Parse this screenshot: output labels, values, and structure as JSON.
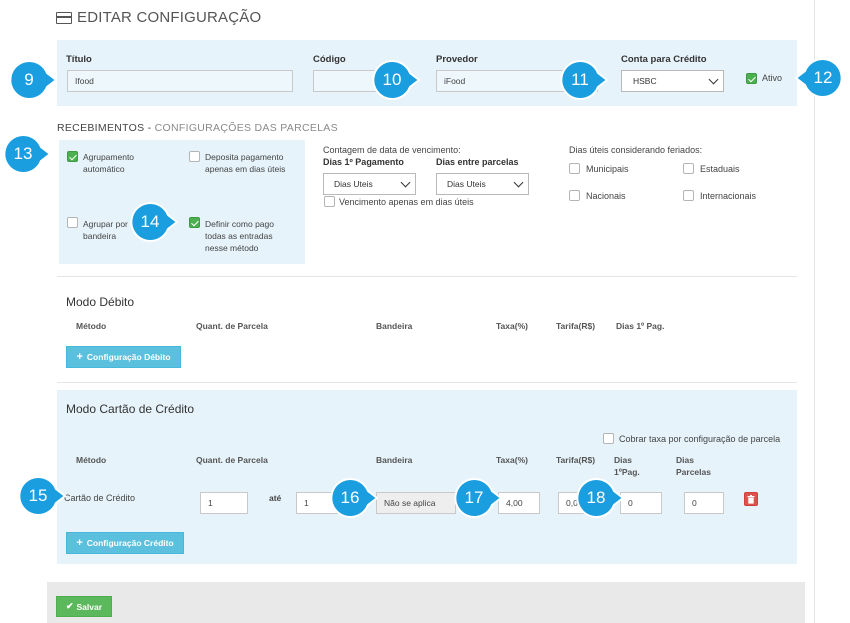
{
  "header": {
    "title": "EDITAR CONFIGURAÇÃO",
    "icon": "credit-card-icon"
  },
  "provider_form": {
    "titulo_label": "Título",
    "titulo_value": "Ifood",
    "codigo_label": "Código",
    "codigo_value": "",
    "provedor_label": "Provedor",
    "provedor_value": "iFood",
    "conta_label": "Conta para Crédito",
    "conta_value": "HSBC",
    "ativo_label": "Ativo",
    "ativo_checked": true
  },
  "recebimentos": {
    "title_main": "RECEBIMENTOS - ",
    "title_sub": "CONFIGURAÇÕES DAS PARCELAS",
    "agrupamento_label": "Agrupamento automático",
    "deposita_label": "Deposita pagamento apenas em dias úteis",
    "agrupar_label": "Agrupar por bandeira",
    "definir_label": "Definir como pago todas as entradas nesse método",
    "contagem_label": "Contagem de data de vencimento:",
    "dias_primeiro_label": "Dias 1º Pagamento",
    "dias_primeiro_value": "Dias Uteis",
    "dias_entre_label": "Dias entre parcelas",
    "dias_entre_value": "Dias Uteis",
    "vencimento_label": "Vencimento apenas em dias úteis",
    "feriados_label": "Dias úteis considerando feriados:",
    "municipais": "Municipais",
    "estaduais": "Estaduais",
    "nacionais": "Nacionais",
    "internacionais": "Internacionais"
  },
  "debito": {
    "title": "Modo Débito",
    "columns": [
      "Método",
      "Quant. de Parcela",
      "Bandeira",
      "Taxa(%)",
      "Tarifa(R$)",
      "Dias 1º Pag."
    ],
    "add_button": "Configuração Débito"
  },
  "credito": {
    "title": "Modo Cartão de Crédito",
    "cobrar_label": "Cobrar taxa por configuração de parcela",
    "columns": {
      "metodo": "Método",
      "quant": "Quant. de Parcela",
      "bandeira": "Bandeira",
      "taxa": "Taxa(%)",
      "tarifa": "Tarifa(R$)",
      "dias_pag": "Dias 1ºPag.",
      "dias_parcelas": "Dias Parcelas"
    },
    "row": {
      "metodo": "Cartão de Crédito",
      "de": "1",
      "ate_label": "até",
      "ate": "1",
      "bandeira": "Não se aplica",
      "taxa": "4,00",
      "tarifa": "0,00",
      "dias_pag": "0",
      "dias_parcelas": "0"
    },
    "add_button": "Configuração Crédito"
  },
  "footer": {
    "save_label": "Salvar"
  },
  "callouts": [
    "9",
    "10",
    "11",
    "12",
    "13",
    "14",
    "15",
    "16",
    "17",
    "18"
  ],
  "colors": {
    "callout": "#1a9ee0",
    "panel": "#e6f3fa",
    "primary_btn": "#5bc0de",
    "success": "#5cb85c",
    "danger": "#d9534f"
  }
}
